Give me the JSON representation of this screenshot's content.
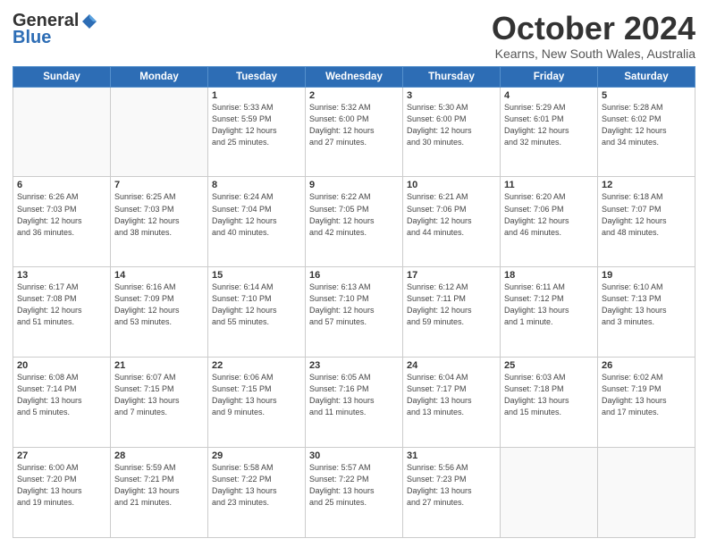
{
  "header": {
    "logo_general": "General",
    "logo_blue": "Blue",
    "month": "October 2024",
    "location": "Kearns, New South Wales, Australia"
  },
  "days_of_week": [
    "Sunday",
    "Monday",
    "Tuesday",
    "Wednesday",
    "Thursday",
    "Friday",
    "Saturday"
  ],
  "weeks": [
    [
      {
        "day": "",
        "info": ""
      },
      {
        "day": "",
        "info": ""
      },
      {
        "day": "1",
        "info": "Sunrise: 5:33 AM\nSunset: 5:59 PM\nDaylight: 12 hours\nand 25 minutes."
      },
      {
        "day": "2",
        "info": "Sunrise: 5:32 AM\nSunset: 6:00 PM\nDaylight: 12 hours\nand 27 minutes."
      },
      {
        "day": "3",
        "info": "Sunrise: 5:30 AM\nSunset: 6:00 PM\nDaylight: 12 hours\nand 30 minutes."
      },
      {
        "day": "4",
        "info": "Sunrise: 5:29 AM\nSunset: 6:01 PM\nDaylight: 12 hours\nand 32 minutes."
      },
      {
        "day": "5",
        "info": "Sunrise: 5:28 AM\nSunset: 6:02 PM\nDaylight: 12 hours\nand 34 minutes."
      }
    ],
    [
      {
        "day": "6",
        "info": "Sunrise: 6:26 AM\nSunset: 7:03 PM\nDaylight: 12 hours\nand 36 minutes."
      },
      {
        "day": "7",
        "info": "Sunrise: 6:25 AM\nSunset: 7:03 PM\nDaylight: 12 hours\nand 38 minutes."
      },
      {
        "day": "8",
        "info": "Sunrise: 6:24 AM\nSunset: 7:04 PM\nDaylight: 12 hours\nand 40 minutes."
      },
      {
        "day": "9",
        "info": "Sunrise: 6:22 AM\nSunset: 7:05 PM\nDaylight: 12 hours\nand 42 minutes."
      },
      {
        "day": "10",
        "info": "Sunrise: 6:21 AM\nSunset: 7:06 PM\nDaylight: 12 hours\nand 44 minutes."
      },
      {
        "day": "11",
        "info": "Sunrise: 6:20 AM\nSunset: 7:06 PM\nDaylight: 12 hours\nand 46 minutes."
      },
      {
        "day": "12",
        "info": "Sunrise: 6:18 AM\nSunset: 7:07 PM\nDaylight: 12 hours\nand 48 minutes."
      }
    ],
    [
      {
        "day": "13",
        "info": "Sunrise: 6:17 AM\nSunset: 7:08 PM\nDaylight: 12 hours\nand 51 minutes."
      },
      {
        "day": "14",
        "info": "Sunrise: 6:16 AM\nSunset: 7:09 PM\nDaylight: 12 hours\nand 53 minutes."
      },
      {
        "day": "15",
        "info": "Sunrise: 6:14 AM\nSunset: 7:10 PM\nDaylight: 12 hours\nand 55 minutes."
      },
      {
        "day": "16",
        "info": "Sunrise: 6:13 AM\nSunset: 7:10 PM\nDaylight: 12 hours\nand 57 minutes."
      },
      {
        "day": "17",
        "info": "Sunrise: 6:12 AM\nSunset: 7:11 PM\nDaylight: 12 hours\nand 59 minutes."
      },
      {
        "day": "18",
        "info": "Sunrise: 6:11 AM\nSunset: 7:12 PM\nDaylight: 13 hours\nand 1 minute."
      },
      {
        "day": "19",
        "info": "Sunrise: 6:10 AM\nSunset: 7:13 PM\nDaylight: 13 hours\nand 3 minutes."
      }
    ],
    [
      {
        "day": "20",
        "info": "Sunrise: 6:08 AM\nSunset: 7:14 PM\nDaylight: 13 hours\nand 5 minutes."
      },
      {
        "day": "21",
        "info": "Sunrise: 6:07 AM\nSunset: 7:15 PM\nDaylight: 13 hours\nand 7 minutes."
      },
      {
        "day": "22",
        "info": "Sunrise: 6:06 AM\nSunset: 7:15 PM\nDaylight: 13 hours\nand 9 minutes."
      },
      {
        "day": "23",
        "info": "Sunrise: 6:05 AM\nSunset: 7:16 PM\nDaylight: 13 hours\nand 11 minutes."
      },
      {
        "day": "24",
        "info": "Sunrise: 6:04 AM\nSunset: 7:17 PM\nDaylight: 13 hours\nand 13 minutes."
      },
      {
        "day": "25",
        "info": "Sunrise: 6:03 AM\nSunset: 7:18 PM\nDaylight: 13 hours\nand 15 minutes."
      },
      {
        "day": "26",
        "info": "Sunrise: 6:02 AM\nSunset: 7:19 PM\nDaylight: 13 hours\nand 17 minutes."
      }
    ],
    [
      {
        "day": "27",
        "info": "Sunrise: 6:00 AM\nSunset: 7:20 PM\nDaylight: 13 hours\nand 19 minutes."
      },
      {
        "day": "28",
        "info": "Sunrise: 5:59 AM\nSunset: 7:21 PM\nDaylight: 13 hours\nand 21 minutes."
      },
      {
        "day": "29",
        "info": "Sunrise: 5:58 AM\nSunset: 7:22 PM\nDaylight: 13 hours\nand 23 minutes."
      },
      {
        "day": "30",
        "info": "Sunrise: 5:57 AM\nSunset: 7:22 PM\nDaylight: 13 hours\nand 25 minutes."
      },
      {
        "day": "31",
        "info": "Sunrise: 5:56 AM\nSunset: 7:23 PM\nDaylight: 13 hours\nand 27 minutes."
      },
      {
        "day": "",
        "info": ""
      },
      {
        "day": "",
        "info": ""
      }
    ]
  ]
}
